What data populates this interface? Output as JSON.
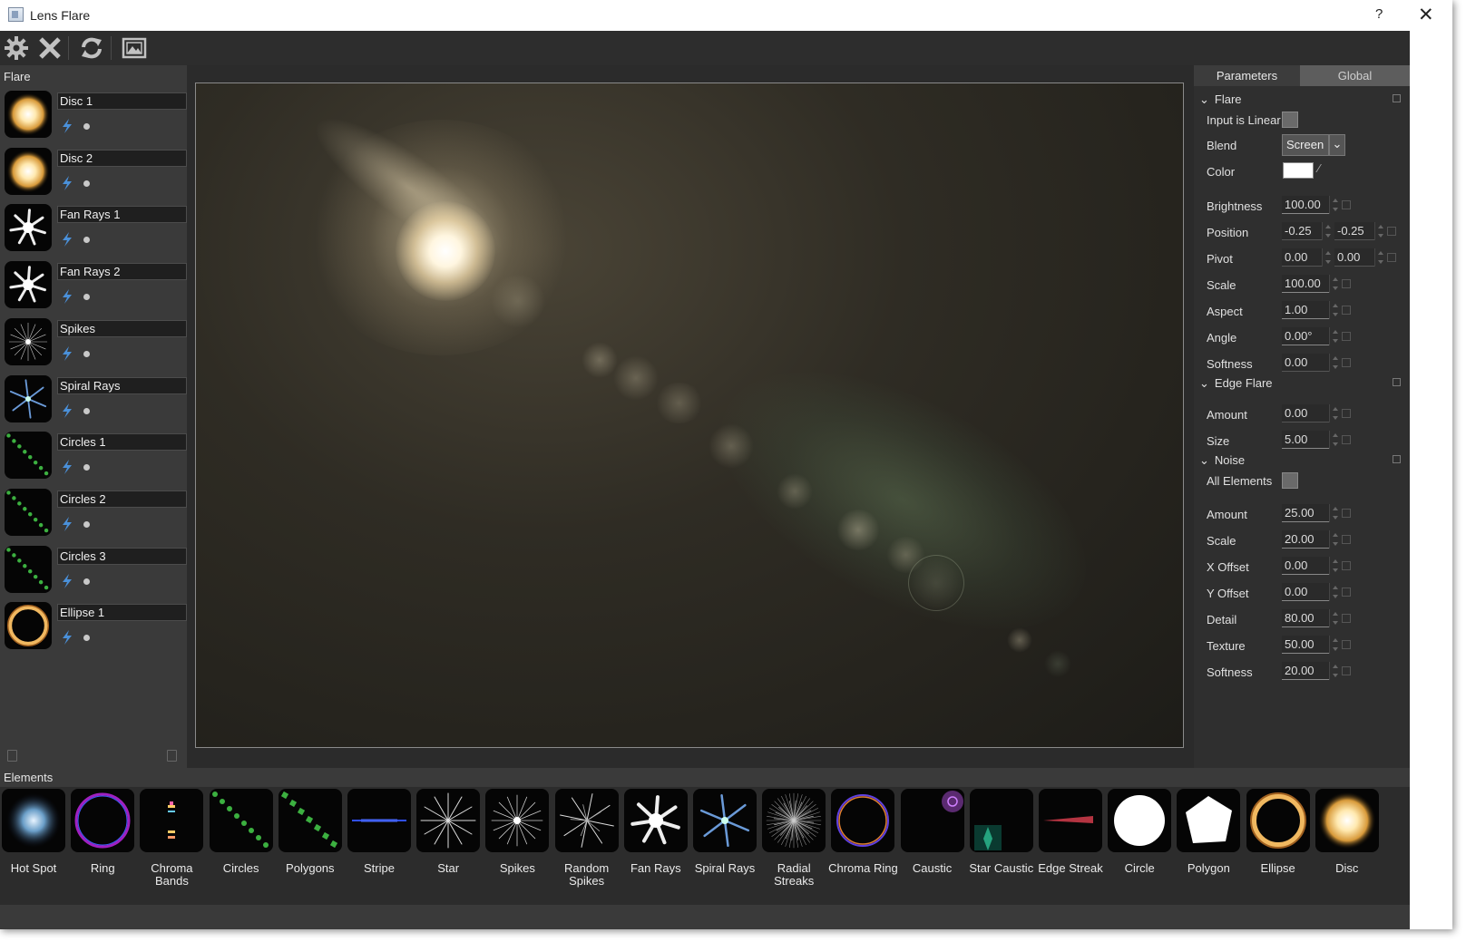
{
  "window": {
    "title": "Lens Flare",
    "help": "?",
    "close": "✕"
  },
  "toolbar": {
    "icons": [
      "gear-icon",
      "close-x-icon",
      "refresh-icon",
      "image-view-icon"
    ]
  },
  "flare_panel": {
    "header": "Flare",
    "items": [
      {
        "label": "Disc 1",
        "thumb": "disc"
      },
      {
        "label": "Disc 2",
        "thumb": "disc"
      },
      {
        "label": "Fan Rays 1",
        "thumb": "fan"
      },
      {
        "label": "Fan Rays 2",
        "thumb": "fan"
      },
      {
        "label": "Spikes",
        "thumb": "spikes"
      },
      {
        "label": "Spiral Rays",
        "thumb": "spiral"
      },
      {
        "label": "Circles 1",
        "thumb": "circles"
      },
      {
        "label": "Circles 2",
        "thumb": "circles"
      },
      {
        "label": "Circles 3",
        "thumb": "circles"
      },
      {
        "label": "Ellipse 1",
        "thumb": "ellipse"
      }
    ]
  },
  "params_panel": {
    "tabs": [
      "Parameters",
      "Global"
    ],
    "active_tab": "Parameters",
    "sections": {
      "flare": {
        "title": "Flare",
        "input_linear_label": "Input is Linear",
        "blend_label": "Blend",
        "blend_value": "Screen",
        "color_label": "Color",
        "brightness_label": "Brightness",
        "brightness": "100.00",
        "position_label": "Position",
        "position_x": "-0.25",
        "position_y": "-0.25",
        "pivot_label": "Pivot",
        "pivot_x": "0.00",
        "pivot_y": "0.00",
        "scale_label": "Scale",
        "scale": "100.00",
        "aspect_label": "Aspect",
        "aspect": "1.00",
        "angle_label": "Angle",
        "angle": "0.00°",
        "softness_label": "Softness",
        "softness": "0.00"
      },
      "edge_flare": {
        "title": "Edge Flare",
        "amount_label": "Amount",
        "amount": "0.00",
        "size_label": "Size",
        "size": "5.00"
      },
      "noise": {
        "title": "Noise",
        "all_elements_label": "All Elements",
        "amount_label": "Amount",
        "amount": "25.00",
        "scale_label": "Scale",
        "scale": "20.00",
        "xoffset_label": "X Offset",
        "xoffset": "0.00",
        "yoffset_label": "Y Offset",
        "yoffset": "0.00",
        "detail_label": "Detail",
        "detail": "80.00",
        "texture_label": "Texture",
        "texture": "50.00",
        "softness_label": "Softness",
        "softness": "20.00"
      }
    }
  },
  "elements_panel": {
    "header": "Elements",
    "items": [
      {
        "label": "Hot Spot",
        "thumb": "hotspot"
      },
      {
        "label": "Ring",
        "thumb": "ring"
      },
      {
        "label": "Chroma Bands",
        "thumb": "chromabands"
      },
      {
        "label": "Circles",
        "thumb": "circles"
      },
      {
        "label": "Polygons",
        "thumb": "polygons"
      },
      {
        "label": "Stripe",
        "thumb": "stripe"
      },
      {
        "label": "Star",
        "thumb": "star"
      },
      {
        "label": "Spikes",
        "thumb": "spikes"
      },
      {
        "label": "Random Spikes",
        "thumb": "randomspikes"
      },
      {
        "label": "Fan Rays",
        "thumb": "fan"
      },
      {
        "label": "Spiral Rays",
        "thumb": "spiral"
      },
      {
        "label": "Radial Streaks",
        "thumb": "radial"
      },
      {
        "label": "Chroma Ring",
        "thumb": "chromaring"
      },
      {
        "label": "Caustic",
        "thumb": "caustic"
      },
      {
        "label": "Star Caustic",
        "thumb": "starcaustic"
      },
      {
        "label": "Edge Streak",
        "thumb": "edgestreak"
      },
      {
        "label": "Circle",
        "thumb": "circle"
      },
      {
        "label": "Polygon",
        "thumb": "polygon"
      },
      {
        "label": "Ellipse",
        "thumb": "ellipse"
      },
      {
        "label": "Disc",
        "thumb": "disc"
      }
    ]
  },
  "colors": {
    "accent_tab": "#4a4a4a",
    "bolt": "#4a90d9",
    "preview_bg": "#24221c"
  }
}
